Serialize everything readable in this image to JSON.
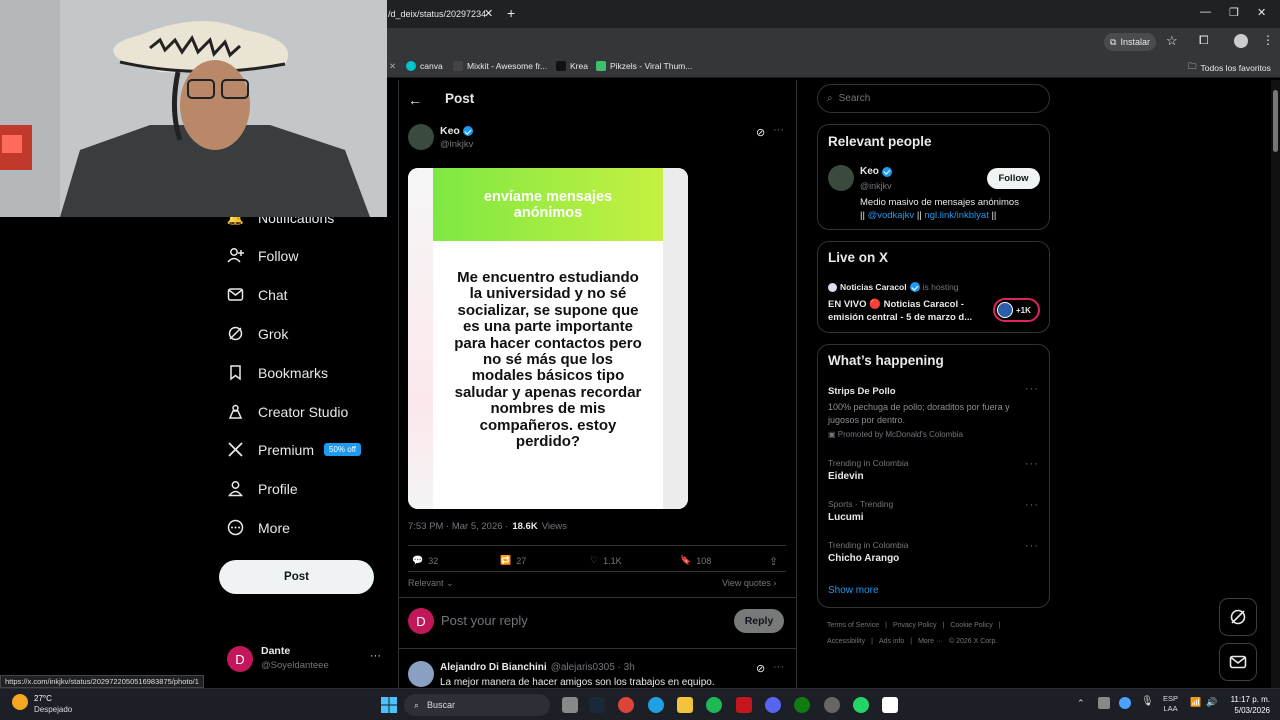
{
  "browser": {
    "tab_url_fragment": "/d_deix/status/20297234",
    "install_label": "Instalar",
    "bookmarks": [
      {
        "label": "canva",
        "icon": "canva-icon",
        "color": "#00c4cc"
      },
      {
        "label": "Mixkit - Awesome fr...",
        "icon": "mixkit-icon",
        "color": "#444"
      },
      {
        "label": "Krea",
        "icon": "krea-icon",
        "color": "#111"
      },
      {
        "label": "Pikzels - Viral Thum...",
        "icon": "pikzels-icon",
        "color": "#3dbf6b"
      }
    ],
    "all_bookmarks_label": "Todos los favoritos",
    "status_url": "https://x.com/inkjkv/status/2029722050516983875/photo/1"
  },
  "sidebar": {
    "items": [
      {
        "label": "Notifications",
        "icon": "bell-icon"
      },
      {
        "label": "Follow",
        "icon": "follow-icon"
      },
      {
        "label": "Chat",
        "icon": "mail-icon"
      },
      {
        "label": "Grok",
        "icon": "grok-icon"
      },
      {
        "label": "Bookmarks",
        "icon": "bookmark-icon"
      },
      {
        "label": "Creator Studio",
        "icon": "creator-studio-icon"
      },
      {
        "label": "Premium",
        "icon": "x-logo-icon",
        "badge": "50% off"
      },
      {
        "label": "Profile",
        "icon": "person-icon"
      },
      {
        "label": "More",
        "icon": "more-circle-icon"
      }
    ],
    "post_button": "Post",
    "account": {
      "name": "Dante",
      "handle": "@Soyeldanteee",
      "initial": "D",
      "avatar_color": "#c2185b"
    }
  },
  "post": {
    "header_title": "Post",
    "author_name": "Keo",
    "author_handle": "@lnkjkv",
    "image": {
      "banner_text": "envíame mensajes anónimos",
      "body_text": "Me encuentro estudiando la universidad y no sé socializar, se supone que es una parte importante para hacer contactos pero no sé más que los modales básicos tipo saludar y apenas recordar nombres de mis compañeros. estoy perdido?"
    },
    "timestamp": "7:53 PM · Mar 5, 2026 ·",
    "views_count": "18.6K",
    "views_label": "Views",
    "stats": {
      "replies": "32",
      "reposts": "27",
      "likes": "1.1K",
      "bookmarks": "108"
    },
    "sort_label": "Relevant",
    "view_quotes_label": "View quotes",
    "reply_placeholder": "Post your reply",
    "reply_button": "Reply",
    "reply_avatar_initial": "D"
  },
  "comment": {
    "name": "Alejandro Di Bianchini",
    "handle": "@alejaris0305 · 3h",
    "text": "La mejor manera de hacer amigos son los trabajos en equipo."
  },
  "right": {
    "search_placeholder": "Search",
    "relevant_title": "Relevant people",
    "person": {
      "name": "Keo",
      "handle": "@inkjkv",
      "follow_label": "Follow",
      "bio_prefix": "Medio masivo de mensajes anónimos",
      "bio_sep1": "||",
      "bio_link1": "@vodkajkv",
      "bio_sep2": "||",
      "bio_link2": "ngl.link/inkblyat",
      "bio_sep3": "||"
    },
    "live_title": "Live on X",
    "live": {
      "host": "Noticias Caracol",
      "hosting_label": "is hosting",
      "title_line1": "EN VIVO 🔴 Noticias Caracol -",
      "title_line2": "emisión central - 5 de marzo d...",
      "count": "+1K"
    },
    "happening_title": "What’s happening",
    "promo": {
      "title": "Strips De Pollo",
      "text_line1": "100% pechuga de pollo; doraditos por fuera y",
      "text_line2": "jugosos por dentro.",
      "promoted": "Promoted by McDonald's Colombia"
    },
    "trends": [
      {
        "context": "Trending in Colombia",
        "name": "Eidevin"
      },
      {
        "context": "Sports · Trending",
        "name": "Lucumi"
      },
      {
        "context": "Trending in Colombia",
        "name": "Chicho Arango"
      }
    ],
    "show_more": "Show more",
    "footer_line1": [
      "Terms of Service",
      "Privacy Policy",
      "Cookie Policy"
    ],
    "footer_line2": [
      "Accessibility",
      "Ads info",
      "More ···",
      "© 2026 X Corp."
    ]
  },
  "taskbar": {
    "weather_temp": "27°C",
    "weather_desc": "Despejado",
    "search_label": "Buscar",
    "lang_top": "ESP",
    "lang_bottom": "LAA",
    "time": "11:17 p. m.",
    "date": "5/03/2026"
  }
}
